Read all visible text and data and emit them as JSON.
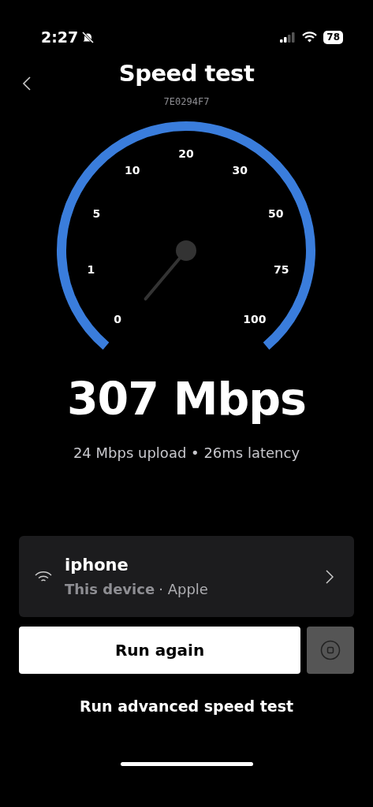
{
  "status_bar": {
    "time": "2:27",
    "battery": "78"
  },
  "header": {
    "title": "Speed test",
    "subtitle": "7E0294F7"
  },
  "gauge": {
    "labels": [
      "0",
      "1",
      "5",
      "10",
      "20",
      "30",
      "50",
      "75",
      "100"
    ]
  },
  "result": {
    "speed": "307 Mbps",
    "details": "24 Mbps upload • 26ms latency"
  },
  "device": {
    "name": "iphone",
    "type": "This device",
    "vendor": "· Apple"
  },
  "buttons": {
    "run_again": "Run again",
    "advanced": "Run advanced speed test"
  }
}
